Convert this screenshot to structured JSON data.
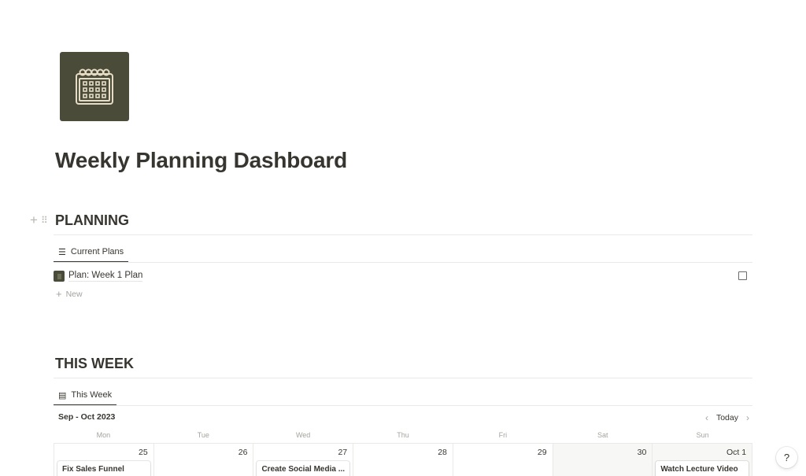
{
  "page": {
    "icon": "calendar-icon",
    "title": "Weekly Planning Dashboard"
  },
  "colors": {
    "icon_bg": "#4a4b38",
    "icon_fg": "#e6dcc6",
    "text": "#37352f",
    "muted": "#a5a39e"
  },
  "planning": {
    "heading": "PLANNING",
    "view_tab": {
      "label": "Current Plans",
      "icon": "list-icon"
    },
    "rows": [
      {
        "title": "Plan: Week 1 Plan",
        "checked": false
      }
    ],
    "new_label": "New"
  },
  "this_week": {
    "heading": "THIS WEEK",
    "view_tab": {
      "label": "This Week",
      "icon": "calendar-view-icon"
    },
    "calendar": {
      "range_label": "Sep - Oct 2023",
      "today_label": "Today",
      "weekdays": [
        "Mon",
        "Tue",
        "Wed",
        "Thu",
        "Fri",
        "Sat",
        "Sun"
      ],
      "days": [
        {
          "label": "25",
          "event": "Fix Sales Funnel",
          "weekend": false
        },
        {
          "label": "26",
          "event": "",
          "weekend": false
        },
        {
          "label": "27",
          "event": "Create Social Media ...",
          "weekend": false
        },
        {
          "label": "28",
          "event": "",
          "weekend": false
        },
        {
          "label": "29",
          "event": "",
          "weekend": false
        },
        {
          "label": "30",
          "event": "",
          "weekend": true
        },
        {
          "label": "Oct 1",
          "event": "Watch Lecture Video",
          "weekend": true
        }
      ]
    }
  },
  "help": {
    "label": "?"
  }
}
